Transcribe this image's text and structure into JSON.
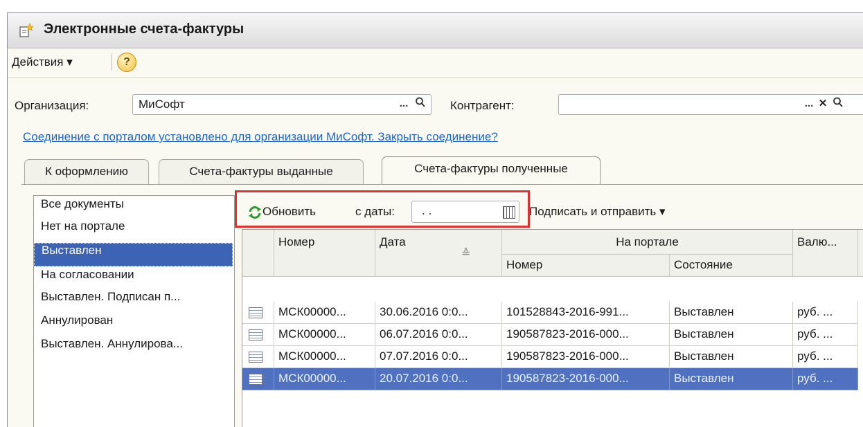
{
  "window": {
    "title": "Электронные счета-фактуры"
  },
  "menu": {
    "actions_label": "Действия ▾",
    "help_icon": "help-icon"
  },
  "filters": {
    "organization_label": "Организация:",
    "organization_value": "МиСофт",
    "counterparty_label": "Контрагент:",
    "counterparty_value": "",
    "ellipsis": "...",
    "search_glyph": "🔍",
    "clear_glyph": "✕"
  },
  "status_link": "Соединение с порталом установлено для организации МиСофт. Закрыть соединение?",
  "tabs": [
    {
      "label": "К оформлению",
      "active": false
    },
    {
      "label": "Счета-фактуры выданные",
      "active": false
    },
    {
      "label": "Счета-фактуры полученные",
      "active": true
    }
  ],
  "status_list": {
    "items": [
      {
        "label": "Все документы"
      },
      {
        "label": "Нет на портале"
      },
      {
        "label": "Выставлен",
        "selected": true
      },
      {
        "label": "На согласовании"
      },
      {
        "label": "Выставлен. Подписан п..."
      },
      {
        "label": "Аннулирован"
      },
      {
        "label": "Выставлен. Аннулирова..."
      }
    ]
  },
  "toolbar": {
    "refresh_label": "Обновить",
    "since_label": "с даты:",
    "date_value": " .  .",
    "sign_send_label": "Подписать и отправить ▾"
  },
  "table": {
    "headers": {
      "number": "Номер",
      "date": "Дата",
      "portal_group": "На портале",
      "portal_number": "Номер",
      "portal_state": "Состояние",
      "currency": "Валю...",
      "sort_indicator": "≙"
    },
    "rows": [
      {
        "number": "МСК00000...",
        "date": "30.06.2016 0:0...",
        "portal_number": "101528843-2016-991...",
        "state": "Выставлен",
        "currency": "руб. ...",
        "selected": false
      },
      {
        "number": "МСК00000...",
        "date": "06.07.2016 0:0...",
        "portal_number": "190587823-2016-000...",
        "state": "Выставлен",
        "currency": "руб. ...",
        "selected": false
      },
      {
        "number": "МСК00000...",
        "date": "07.07.2016 0:0...",
        "portal_number": "190587823-2016-000...",
        "state": "Выставлен",
        "currency": "руб. ...",
        "selected": false
      },
      {
        "number": "МСК00000...",
        "date": "20.07.2016 0:0...",
        "portal_number": "190587823-2016-000...",
        "state": "Выставлен",
        "currency": "руб. ...",
        "selected": true
      }
    ]
  },
  "colors": {
    "accent": "#3c63b4",
    "link": "#2066c8",
    "highlight_box": "#e03030"
  }
}
